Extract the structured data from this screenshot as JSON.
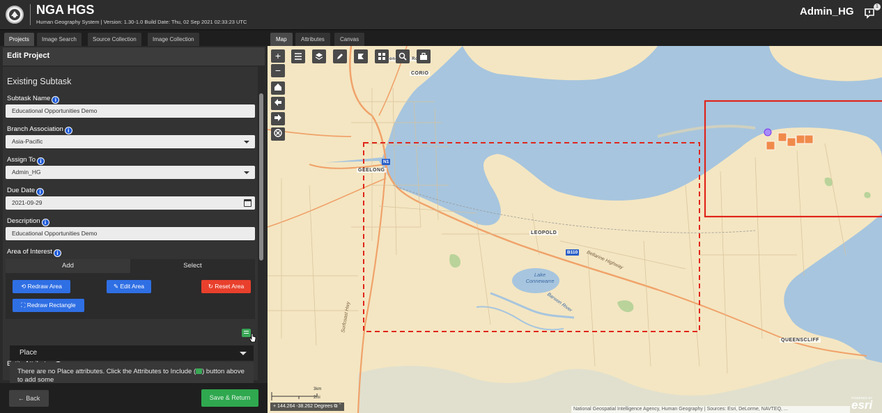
{
  "header": {
    "app_title": "NGA HGS",
    "app_subtitle": "Human Geography System | Version: 1.30-1.0 Build Date: Thu, 02 Sep 2021 02:33:23 UTC",
    "user_name": "Admin_HG",
    "notification_count": "1"
  },
  "left_tabs": [
    "Projects",
    "Image Search",
    "Source Collection",
    "Image Collection"
  ],
  "panel_title": "Edit Project",
  "form": {
    "section_title": "Existing Subtask",
    "subtask_name_label": "Subtask Name",
    "subtask_name_value": "Educational Opportunities Demo",
    "branch_label": "Branch Association",
    "branch_value": "Asia-Pacific",
    "assign_label": "Assign To",
    "assign_value": "Admin_HG",
    "due_label": "Due Date",
    "due_value": "2021-09-29",
    "description_label": "Description",
    "description_value": "Educational Opportunities Demo",
    "aoi_label": "Area of Interest",
    "aoi_tab_add": "Add",
    "aoi_tab_select": "Select",
    "btn_redraw_area": "Redraw Area",
    "btn_edit_area": "Edit Area",
    "btn_reset_area": "Reset Area",
    "btn_redraw_rectangle": "Redraw Rectangle",
    "entity_attributes_label": "Entity Attributes",
    "place_select_value": "Place",
    "place_message_before": "There are no Place attributes. Click the Attributes to Include (",
    "place_message_after": ") button above to add some"
  },
  "footer": {
    "back_label": "Back",
    "save_label": "Save & Return"
  },
  "map_tabs": [
    "Map",
    "Attributes",
    "Canvas"
  ],
  "map": {
    "labels": {
      "geelong": "GEELONG",
      "corio": "CORIO",
      "leopold": "LEOPOLD",
      "queenscliff": "QUEENSCLIFF",
      "top_partial": "Geelong Ring Rd",
      "shield_n1": "N1",
      "shield_b110": "B110",
      "bellarine_hwy": "Bellarine Highway",
      "surfcoast_hwy": "Surfcoast Hwy",
      "barwon_river": "Barwon River",
      "lake_connewarre": "Lake Connewarre"
    },
    "scale_km": "3km",
    "scale_mi": "2mi",
    "coordinates": "144.264 -38.262 Degrees",
    "attribution": "National Geospatial Intelligence Agency, Human Geography | Sources: Esri, DeLorme, NAVTEQ, ...",
    "esri_powered": "POWERED BY",
    "esri_logo": "esri",
    "zoom_in": "+",
    "zoom_out": "−"
  },
  "colors": {
    "accent_blue": "#2f6fe4",
    "reset_red": "#e8402c",
    "save_green": "#2fa84f",
    "aoi_outline": "#e0251b",
    "land": "#f4e6c2",
    "water": "#a7c5de"
  }
}
